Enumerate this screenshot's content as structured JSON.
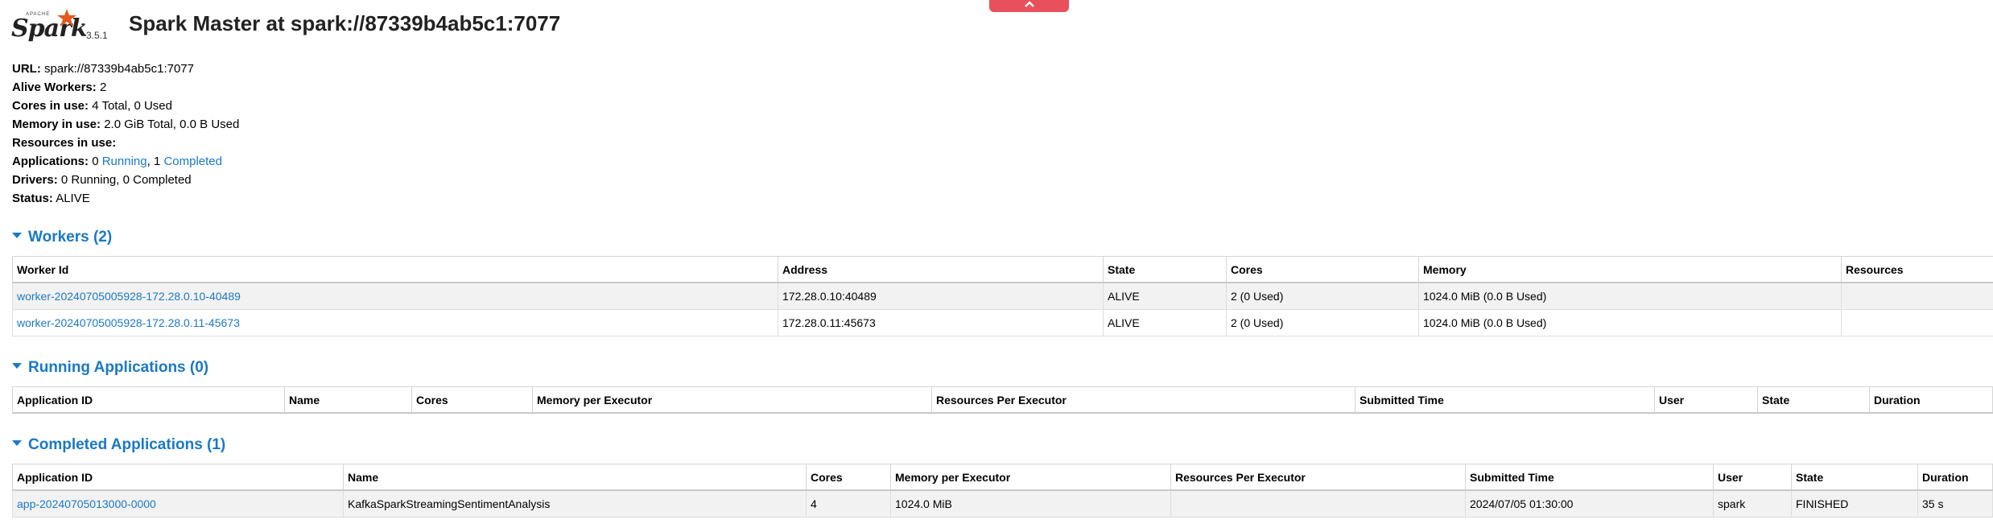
{
  "header": {
    "logo_text": "Spark",
    "logo_apache": "APACHE",
    "version": "3.5.1",
    "title": "Spark Master at spark://87339b4ab5c1:7077"
  },
  "summary": {
    "url_label": "URL:",
    "url_value": "spark://87339b4ab5c1:7077",
    "alive_workers_label": "Alive Workers:",
    "alive_workers_value": "2",
    "cores_label": "Cores in use:",
    "cores_value": "4 Total, 0 Used",
    "memory_label": "Memory in use:",
    "memory_value": "2.0 GiB Total, 0.0 B Used",
    "resources_label": "Resources in use:",
    "applications_label": "Applications:",
    "apps_running_count": "0",
    "apps_running_link": "Running",
    "apps_sep": ",",
    "apps_completed_count": "1",
    "apps_completed_link": "Completed",
    "drivers_label": "Drivers:",
    "drivers_value": "0 Running, 0 Completed",
    "status_label": "Status:",
    "status_value": "ALIVE"
  },
  "workers": {
    "heading": "Workers (2)",
    "columns": [
      "Worker Id",
      "Address",
      "State",
      "Cores",
      "Memory",
      "Resources"
    ],
    "rows": [
      [
        "worker-20240705005928-172.28.0.10-40489",
        "172.28.0.10:40489",
        "ALIVE",
        "2 (0 Used)",
        "1024.0 MiB (0.0 B Used)",
        ""
      ],
      [
        "worker-20240705005928-172.28.0.11-45673",
        "172.28.0.11:45673",
        "ALIVE",
        "2 (0 Used)",
        "1024.0 MiB (0.0 B Used)",
        ""
      ]
    ]
  },
  "running_apps": {
    "heading": "Running Applications (0)",
    "columns": [
      "Application ID",
      "Name",
      "Cores",
      "Memory per Executor",
      "Resources Per Executor",
      "Submitted Time",
      "User",
      "State",
      "Duration"
    ]
  },
  "completed_apps": {
    "heading": "Completed Applications (1)",
    "columns": [
      "Application ID",
      "Name",
      "Cores",
      "Memory per Executor",
      "Resources Per Executor",
      "Submitted Time",
      "User",
      "State",
      "Duration"
    ],
    "rows": [
      [
        "app-20240705013000-0000",
        "KafkaSparkStreamingSentimentAnalysis",
        "4",
        "1024.0 MiB",
        "",
        "2024/07/05 01:30:00",
        "spark",
        "FINISHED",
        "35 s"
      ]
    ]
  },
  "colors": {
    "link": "#1a79c4",
    "logo_star": "#e25a1c",
    "top_tab": "#e8505b"
  },
  "icons": {
    "collapse": "caret-down-icon",
    "top_tab": "chevron-up-icon",
    "logo": "spark-star-icon"
  }
}
